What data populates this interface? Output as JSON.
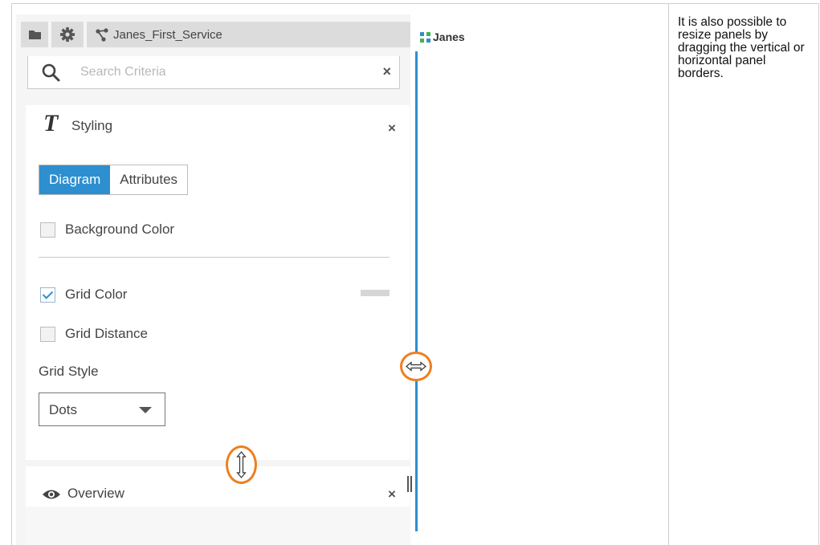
{
  "toolbar": {
    "folder_icon": "folder-icon",
    "settings_icon": "gear-icon",
    "service_tab_label": "Janes_First_Service"
  },
  "search": {
    "placeholder": "Search Criteria",
    "clear_label": "×"
  },
  "styling_panel": {
    "icon_letter": "T",
    "title": "Styling",
    "close_label": "×",
    "tabs": [
      {
        "label": "Diagram",
        "active": true
      },
      {
        "label": "Attributes",
        "active": false
      }
    ],
    "options": [
      {
        "label": "Background Color",
        "checked": false
      },
      {
        "label": "Grid Color",
        "checked": true
      },
      {
        "label": "Grid Distance",
        "checked": false
      }
    ],
    "grid_color_value": "#d6d6d6",
    "grid_style": {
      "label": "Grid Style",
      "selected": "Dots"
    }
  },
  "overview_panel": {
    "title": "Overview",
    "close_label": "×"
  },
  "editor_tab": {
    "label": "Janes"
  },
  "note": {
    "text": "It is also possible to resize panels by dragging the vertical or horizontal panel borders."
  },
  "colors": {
    "accent": "#2d8fd0",
    "highlight_ring": "#ee7f1e"
  }
}
